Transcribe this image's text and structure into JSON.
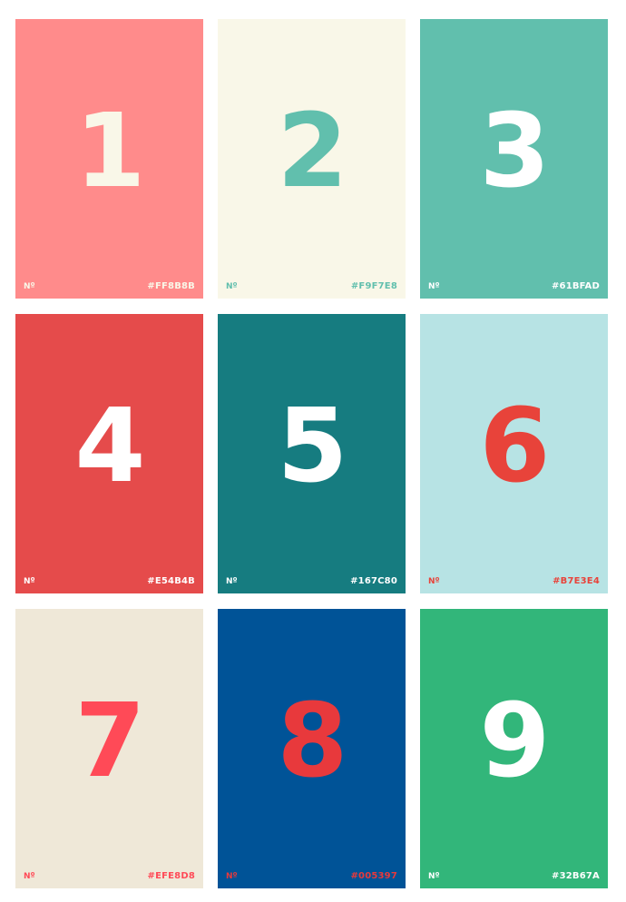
{
  "cards": [
    {
      "numeral": "1",
      "prefix": "Nº",
      "hex": "#FF8B8B",
      "bg": "#FF8B8B",
      "numeral_color": "#F9F7E8",
      "label_color": "#F9F7E8"
    },
    {
      "numeral": "2",
      "prefix": "Nº",
      "hex": "#F9F7E8",
      "bg": "#F9F7E8",
      "numeral_color": "#61BFAD",
      "label_color": "#61BFAD"
    },
    {
      "numeral": "3",
      "prefix": "Nº",
      "hex": "#61BFAD",
      "bg": "#61BFAD",
      "numeral_color": "#FFFFFF",
      "label_color": "#FFFFFF"
    },
    {
      "numeral": "4",
      "prefix": "Nº",
      "hex": "#E54B4B",
      "bg": "#E54B4B",
      "numeral_color": "#FFFFFF",
      "label_color": "#FFFFFF"
    },
    {
      "numeral": "5",
      "prefix": "Nº",
      "hex": "#167C80",
      "bg": "#167C80",
      "numeral_color": "#FFFFFF",
      "label_color": "#FFFFFF"
    },
    {
      "numeral": "6",
      "prefix": "Nº",
      "hex": "#B7E3E4",
      "bg": "#B7E3E4",
      "numeral_color": "#E8433A",
      "label_color": "#E8433A"
    },
    {
      "numeral": "7",
      "prefix": "Nº",
      "hex": "#EFE8D8",
      "bg": "#EFE8D8",
      "numeral_color": "#FF4A57",
      "label_color": "#FF4A57"
    },
    {
      "numeral": "8",
      "prefix": "Nº",
      "hex": "#005397",
      "bg": "#005397",
      "numeral_color": "#E8393C",
      "label_color": "#E8393C"
    },
    {
      "numeral": "9",
      "prefix": "Nº",
      "hex": "#32B67A",
      "bg": "#32B67A",
      "numeral_color": "#FFFFFF",
      "label_color": "#FFFFFF"
    }
  ]
}
